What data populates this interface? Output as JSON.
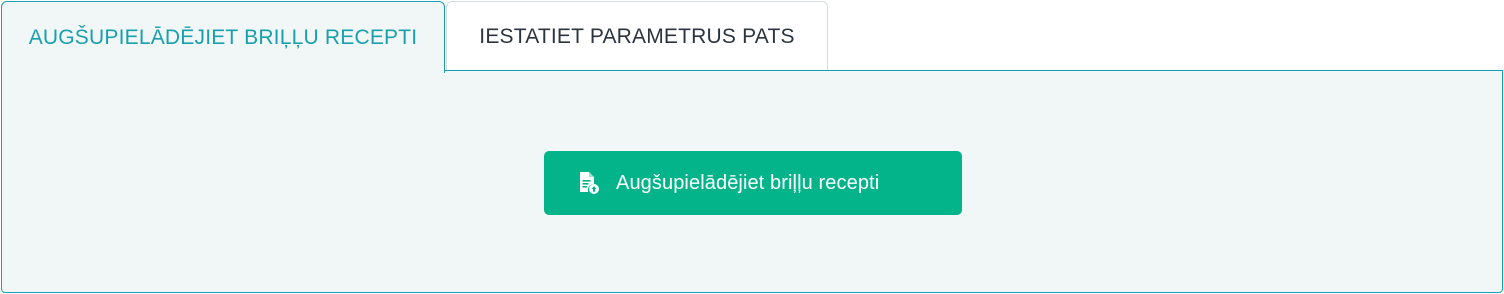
{
  "tabs": [
    {
      "label": "AUGŠUPIELĀDĒJIET BRIĻĻU RECEPTI",
      "active": true
    },
    {
      "label": "IESTATIET PARAMETRUS PATS",
      "active": false
    }
  ],
  "upload": {
    "button_label": "Augšupielādējiet briļļu recepti",
    "icon": "file-upload-icon"
  },
  "colors": {
    "accent": "#1aa0ad",
    "button": "#03b48a",
    "panel_bg": "#f1f6f6",
    "inactive_text": "#2b3440"
  }
}
